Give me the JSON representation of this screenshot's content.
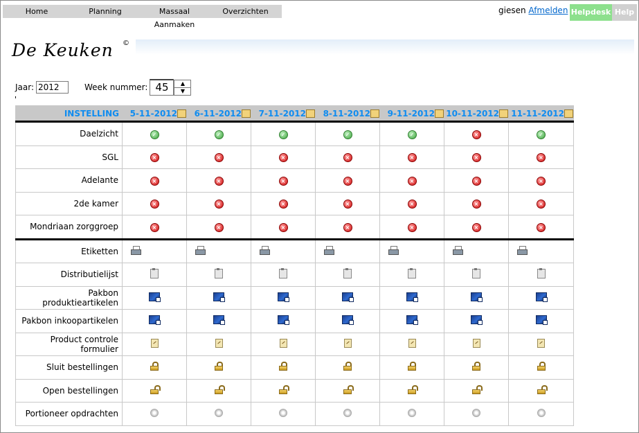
{
  "nav": {
    "items": [
      "Home",
      "Planning",
      "Massaal Aanmaken",
      "Overzichten"
    ]
  },
  "user": {
    "name": "giesen",
    "logout": "Afmelden",
    "helpdesk": "Helpdesk",
    "help": "Help"
  },
  "logo": {
    "text": "De Keuken",
    "mark": "©"
  },
  "controls": {
    "jaar_label": "Jaar:",
    "jaar_value": "2012",
    "week_label": "Week nummer:",
    "week_value": "45"
  },
  "table": {
    "header_label": "INSTELLING",
    "dates": [
      "5-11-2012",
      "6-11-2012",
      "7-11-2012",
      "8-11-2012",
      "9-11-2012",
      "10-11-2012",
      "11-11-2012"
    ],
    "institutions": [
      {
        "name": "Daelzicht",
        "status": [
          "ok",
          "ok",
          "ok",
          "ok",
          "ok",
          "no",
          "ok"
        ]
      },
      {
        "name": "SGL",
        "status": [
          "no",
          "no",
          "no",
          "no",
          "no",
          "no",
          "no"
        ]
      },
      {
        "name": "Adelante",
        "status": [
          "no",
          "no",
          "no",
          "no",
          "no",
          "no",
          "no"
        ]
      },
      {
        "name": "2de kamer",
        "status": [
          "no",
          "no",
          "no",
          "no",
          "no",
          "no",
          "no"
        ]
      },
      {
        "name": "Mondriaan zorggroep",
        "status": [
          "no",
          "no",
          "no",
          "no",
          "no",
          "no",
          "no"
        ]
      }
    ],
    "actions": [
      {
        "name": "Etiketten",
        "icon": "printer-icon"
      },
      {
        "name": "Distributielijst",
        "icon": "clipboard-icon"
      },
      {
        "name": "Pakbon produktieartikelen",
        "icon": "pakbon-icon"
      },
      {
        "name": "Pakbon inkoopartikelen",
        "icon": "pakbon-icon"
      },
      {
        "name": "Product controle formulier",
        "icon": "form-icon"
      },
      {
        "name": "Sluit bestellingen",
        "icon": "lock-icon"
      },
      {
        "name": "Open bestellingen",
        "icon": "unlock-icon"
      },
      {
        "name": "Portioneer opdrachten",
        "icon": "radio-icon"
      }
    ]
  }
}
